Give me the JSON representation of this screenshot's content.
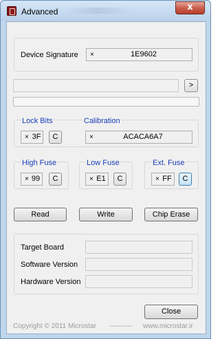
{
  "window": {
    "title": "Advanced",
    "close_glyph": "x"
  },
  "signature": {
    "label": "Device Signature",
    "prefix": "×",
    "value": "1E9602"
  },
  "arrow_button": {
    "label": ">"
  },
  "lock_bits": {
    "label": "Lock Bits",
    "prefix": "×",
    "value": "3F",
    "button": "C"
  },
  "calibration": {
    "label": "Calibration",
    "prefix": "×",
    "value": "ACACA6A7"
  },
  "high_fuse": {
    "label": "High Fuse",
    "prefix": "×",
    "value": "99",
    "button": "C"
  },
  "low_fuse": {
    "label": "Low Fuse",
    "prefix": "×",
    "value": "E1",
    "button": "C"
  },
  "ext_fuse": {
    "label": "Ext. Fuse",
    "prefix": "×",
    "value": "FF",
    "button": "C"
  },
  "actions": {
    "read": "Read",
    "write": "Write",
    "chip_erase": "Chip Erase"
  },
  "info": {
    "target_board": {
      "label": "Target Board",
      "value": ""
    },
    "software_version": {
      "label": "Software Version",
      "value": ""
    },
    "hardware_version": {
      "label": "Hardware Version",
      "value": ""
    }
  },
  "close_button": {
    "label": "Close"
  },
  "footer": {
    "copyright": "Copyright © 2011 Microstar",
    "separator": "----------",
    "website": "www.microstar.ir"
  },
  "colors": {
    "group_label": "#1a3db8",
    "titlebar": "#bfd6ec",
    "close": "#c75a48"
  }
}
